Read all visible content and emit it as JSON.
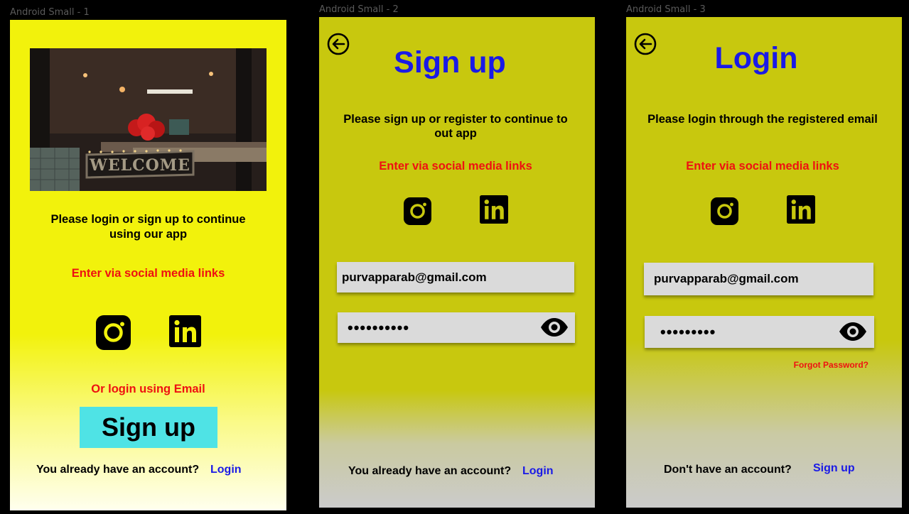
{
  "frames": {
    "f1": {
      "frame_label": "Android Small - 1",
      "photo_sign": "WELCOME",
      "tagline": "Please login or sign up to continue using our app",
      "social_prompt": "Enter via social media links",
      "email_prompt": "Or login using Email",
      "signup_button": "Sign up",
      "account_question": "You already have an account?",
      "login_link": "Login"
    },
    "f2": {
      "frame_label": "Android Small - 2",
      "title": "Sign up",
      "tagline": "Please sign up or register to continue to out app",
      "social_prompt": "Enter via social media links",
      "email_value": "purvapparab@gmail.com",
      "password_mask": "••••••••••",
      "account_question": "You already have an account?",
      "login_link": "Login"
    },
    "f3": {
      "frame_label": "Android Small - 3",
      "title": "Login",
      "tagline": "Please login through the registered email",
      "social_prompt": "Enter via social media links",
      "email_value": "purvapparab@gmail.com",
      "password_mask": "•••••••••",
      "forgot_password": "Forgot Password?",
      "account_question": "Don't have an account?",
      "signup_link": "Sign up"
    }
  },
  "icons": {
    "instagram": "instagram-icon",
    "linkedin": "linkedin-icon",
    "back": "back-arrow-icon",
    "eye": "eye-icon"
  },
  "colors": {
    "title_blue": "#1a1ae6",
    "prompt_red": "#ee1111",
    "link_blue": "#1a1ae6",
    "signup_button": "#4fe3e5",
    "frame1_bg": "#f2f20c",
    "frame2_bg": "#c8c80e"
  }
}
